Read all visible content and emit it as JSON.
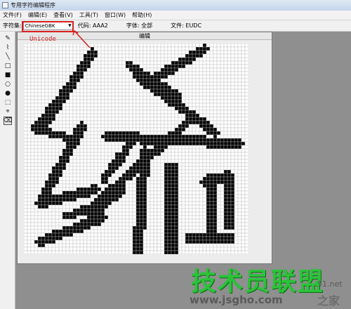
{
  "window": {
    "title": "专用字符编辑程序"
  },
  "menu": [
    {
      "label": "文件(F)"
    },
    {
      "label": "编辑(E)"
    },
    {
      "label": "查看(V)"
    },
    {
      "label": "工具(T)"
    },
    {
      "label": "窗口(W)"
    },
    {
      "label": "帮助(H)"
    }
  ],
  "toolbar": {
    "charset_label": "字符集:",
    "charset_value": "ChineseGBK",
    "code_label": "代码: AAA2",
    "font_label": "字体: 全部",
    "file_label": "文件: EUDC"
  },
  "annotation": {
    "note": "Unicode",
    "color": "#e02020"
  },
  "tools": [
    {
      "icon": "pencil-icon",
      "glyph": "✎"
    },
    {
      "icon": "brush-icon",
      "glyph": "⌇"
    },
    {
      "icon": "line-icon",
      "glyph": "╲"
    },
    {
      "icon": "hollow-rectangle-icon",
      "glyph": "□"
    },
    {
      "icon": "filled-rectangle-icon",
      "glyph": "■"
    },
    {
      "icon": "hollow-ellipse-icon",
      "glyph": "○"
    },
    {
      "icon": "filled-ellipse-icon",
      "glyph": "●"
    },
    {
      "icon": "rect-select-icon",
      "glyph": "⬚"
    },
    {
      "icon": "freeform-select-icon",
      "glyph": "⌖"
    },
    {
      "icon": "eraser-icon",
      "glyph": "⌫"
    }
  ],
  "editor": {
    "title": "编辑",
    "grid_columns": 64,
    "grid_rows": 60,
    "pixel_color": "#000000",
    "grid_line_color": "#b9b9b9"
  },
  "watermark": {
    "brand": "技术员联盟",
    "url": "www.jsgho.com",
    "side_top": "51.net",
    "side_bottom": "之家"
  }
}
